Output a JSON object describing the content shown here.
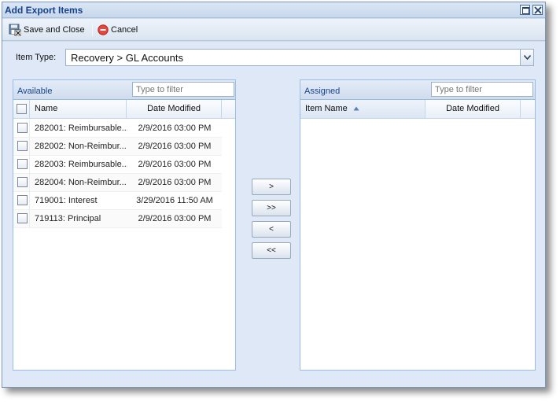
{
  "window": {
    "title": "Add Export Items"
  },
  "toolbar": {
    "save_label": "Save and Close",
    "cancel_label": "Cancel"
  },
  "item_type": {
    "label": "Item Type:",
    "value": "Recovery > GL Accounts"
  },
  "available": {
    "title": "Available",
    "filter_placeholder": "Type to filter",
    "columns": {
      "name": "Name",
      "date": "Date Modified"
    },
    "rows": [
      {
        "name": "282001: Reimbursable...",
        "date": "2/9/2016 03:00 PM"
      },
      {
        "name": "282002: Non-Reimbur...",
        "date": "2/9/2016 03:00 PM"
      },
      {
        "name": "282003: Reimbursable...",
        "date": "2/9/2016 03:00 PM"
      },
      {
        "name": "282004: Non-Reimbur...",
        "date": "2/9/2016 03:00 PM"
      },
      {
        "name": "719001: Interest",
        "date": "3/29/2016 11:50 AM"
      },
      {
        "name": "719113: Principal",
        "date": "2/9/2016 03:00 PM"
      }
    ]
  },
  "assigned": {
    "title": "Assigned",
    "filter_placeholder": "Type to filter",
    "columns": {
      "name": "Item Name",
      "date": "Date Modified"
    },
    "sort": "ascending"
  },
  "move_buttons": {
    "add_one": ">",
    "add_all": ">>",
    "remove_one": "<",
    "remove_all": "<<"
  }
}
